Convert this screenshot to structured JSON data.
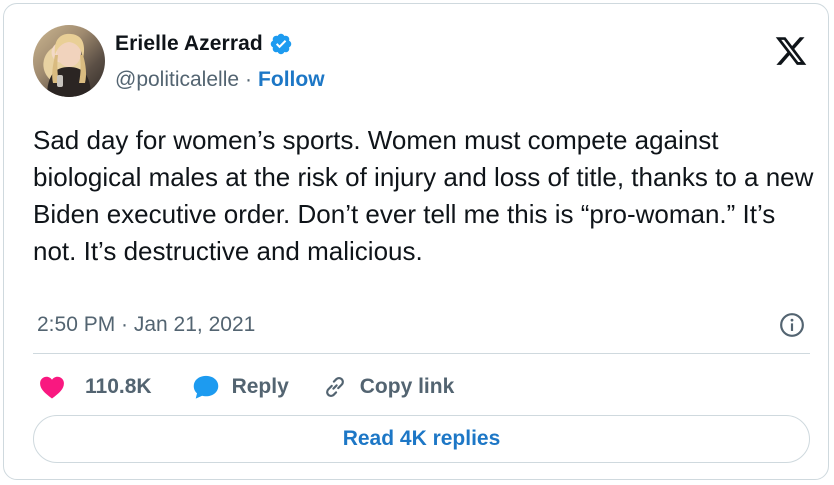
{
  "author": {
    "name": "Erielle Azerrad",
    "handle": "@politicalelle",
    "separator": "·",
    "follow_label": "Follow",
    "verified_color": "#1d9bf0"
  },
  "platform_icon": "x-logo-icon",
  "tweet": {
    "text": "Sad day for women’s sports. Women must compete against biological males at the risk of injury and loss of title, thanks to a new Biden executive order. Don’t ever tell me this is “pro-woman.” It’s not. It’s destructive and malicious.",
    "timestamp": "2:50 PM · Jan 21, 2021"
  },
  "actions": {
    "likes": "110.8K",
    "reply_label": "Reply",
    "copy_link_label": "Copy link"
  },
  "replies_button": "Read 4K replies",
  "colors": {
    "accent": "#1d77c6",
    "heart": "#f91880",
    "reply_icon": "#1d9bf0",
    "muted": "#536471"
  }
}
